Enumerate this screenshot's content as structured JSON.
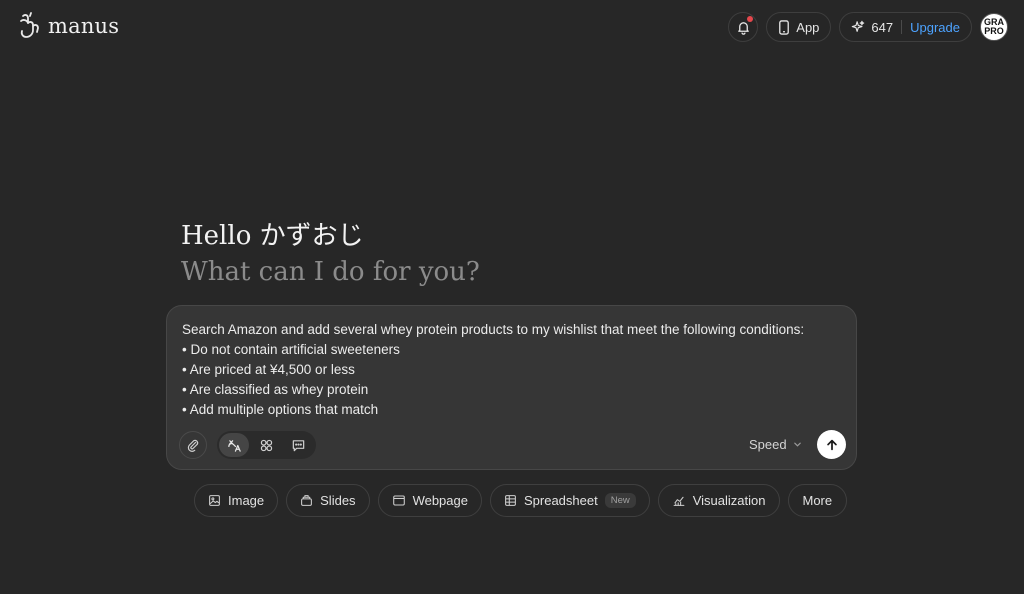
{
  "header": {
    "brand": "manus",
    "app_label": "App",
    "credits": "647",
    "upgrade_label": "Upgrade",
    "avatar_line1": "GRA",
    "avatar_line2": "PRO",
    "notification_dot_color": "#e5484d"
  },
  "greeting": {
    "hello": "Hello かずおじ",
    "question": "What can I do for you?"
  },
  "composer": {
    "prompt_lines": [
      "Search Amazon and add several whey protein products to my wishlist that meet the following conditions:",
      "• Do not contain artificial sweeteners",
      "• Are priced at ¥4,500 or less",
      "• Are classified as whey protein",
      "• Add multiple options that match"
    ],
    "speed_label": "Speed",
    "icons": [
      "paperclip-icon",
      "agent-mode-icon",
      "cluster-mode-icon",
      "chat-mode-icon",
      "chevron-down-icon",
      "arrow-up-icon"
    ]
  },
  "chips": {
    "image": "Image",
    "slides": "Slides",
    "webpage": "Webpage",
    "spreadsheet": "Spreadsheet",
    "spreadsheet_badge": "New",
    "visualization": "Visualization",
    "more": "More"
  },
  "colors": {
    "background": "#272727",
    "composer_bg": "#363636",
    "accent_link": "#4da3ff"
  }
}
